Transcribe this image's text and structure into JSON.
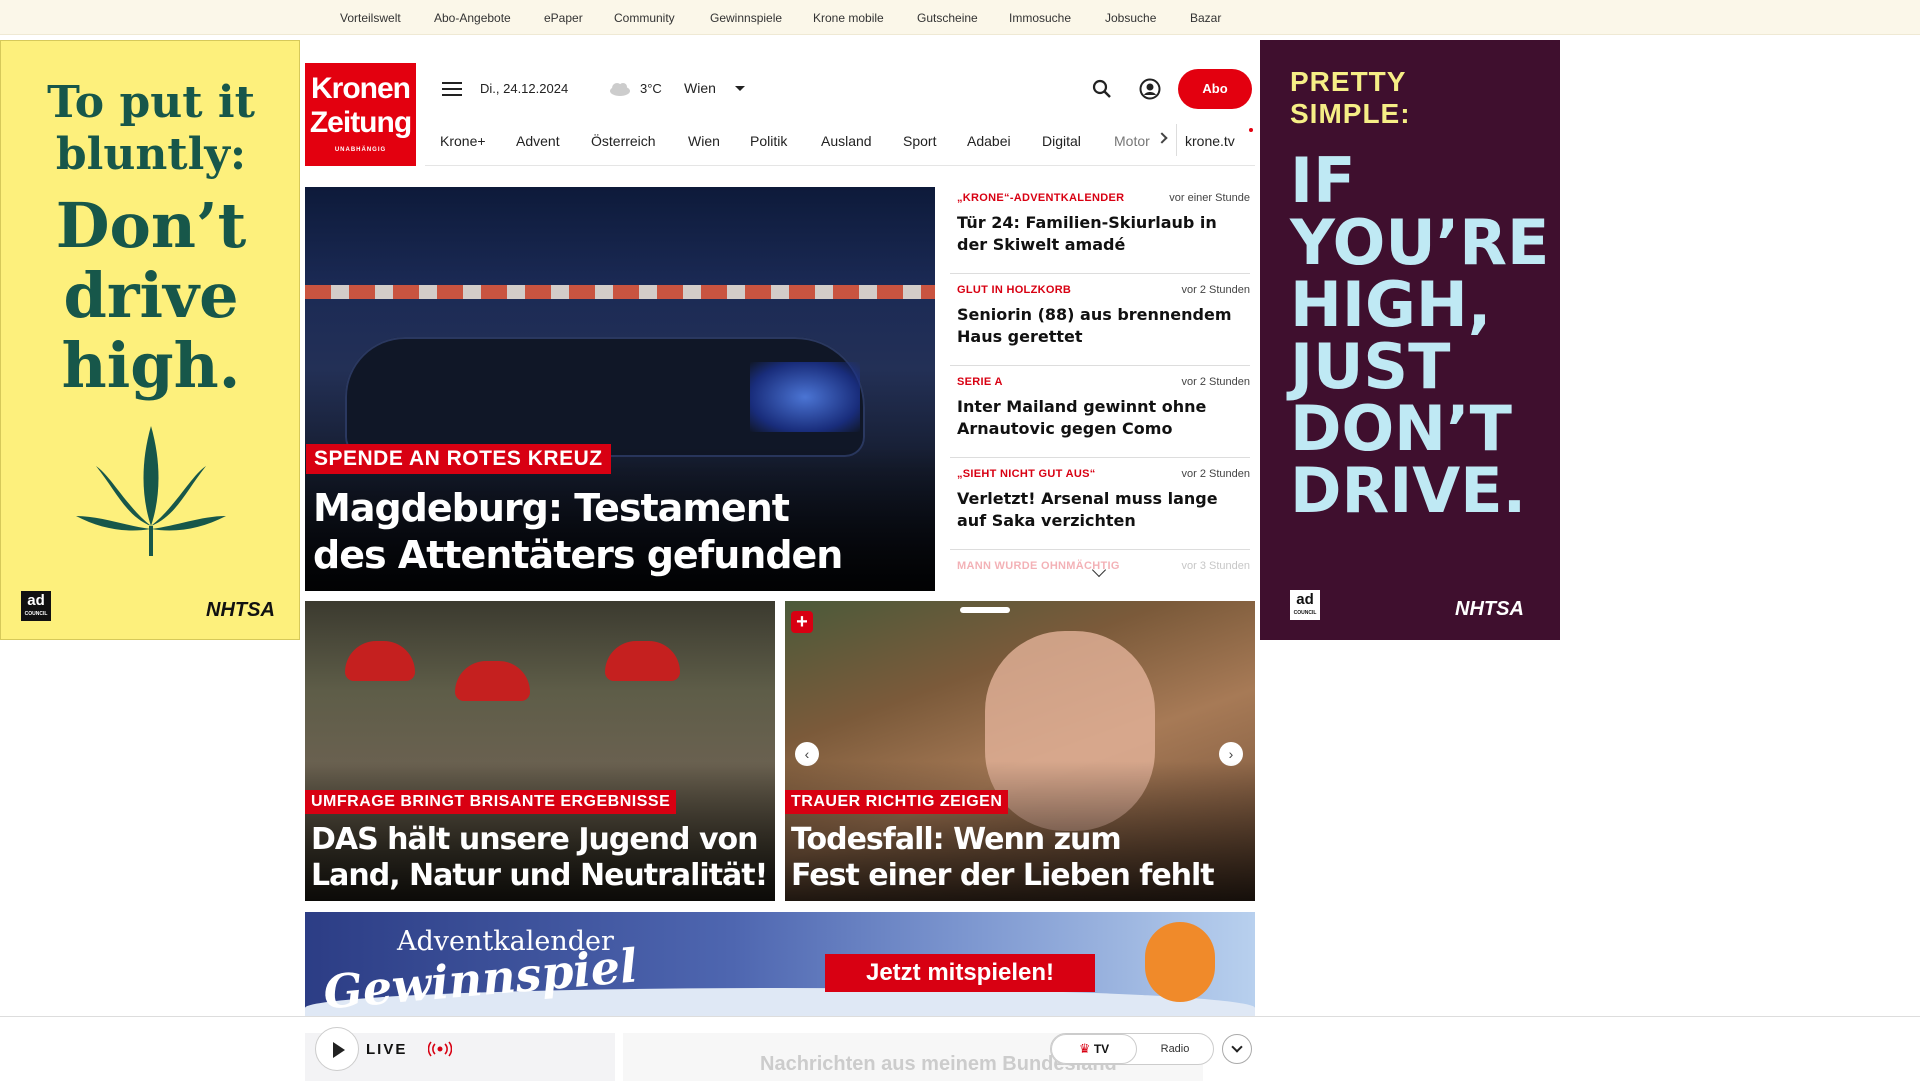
{
  "topnav": [
    "Vorteilswelt",
    "Abo-Angebote",
    "ePaper",
    "Community",
    "Gewinnspiele",
    "Krone mobile",
    "Gutscheine",
    "Immosuche",
    "Jobsuche",
    "Bazar"
  ],
  "ad_left": {
    "line1": "To put it",
    "line2": "bluntly:",
    "line3": "Don’t",
    "line4": "drive",
    "line5": "high.",
    "ad_council": "ad",
    "ad_council_sub": "COUNCIL",
    "nhtsa": "NHTSA"
  },
  "ad_right": {
    "top1": "PRETTY",
    "top2": "SIMPLE:",
    "l1": "IF",
    "l2": "YOU’RE",
    "l3": "HIGH,",
    "l4": "JUST",
    "l5": "DON’T",
    "l6": "DRIVE.",
    "ad_council": "ad",
    "ad_council_sub": "COUNCIL",
    "nhtsa": "NHTSA"
  },
  "logo": {
    "line1": "Kronen",
    "line2": "Zeitung",
    "sub": "UNABHÄNGIG"
  },
  "header": {
    "date": "Di., 24.12.2024",
    "temp": "3°C",
    "city": "Wien",
    "abo": "Abo"
  },
  "nav": [
    "Krone+",
    "Advent",
    "Österreich",
    "Wien",
    "Politik",
    "Ausland",
    "Sport",
    "Adabei",
    "Digital",
    "Motor"
  ],
  "nav_tv": "krone.tv",
  "hero": {
    "tag": "SPENDE AN ROTES KREUZ",
    "title1": "Magdeburg: Testament",
    "title2": "des Attentäters gefunden"
  },
  "news": [
    {
      "kicker": "„KRONE“-ADVENTKALENDER",
      "time": "vor einer Stunde",
      "title": "Tür 24: Familien-Skiurlaub in der Skiwelt amadé"
    },
    {
      "kicker": "GLUT IN HOLZKORB",
      "time": "vor 2 Stunden",
      "title": "Seniorin (88) aus brennendem Haus gerettet"
    },
    {
      "kicker": "SERIE A",
      "time": "vor 2 Stunden",
      "title": "Inter Mailand gewinnt ohne Arnautovic gegen Como"
    },
    {
      "kicker": "„SIEHT NICHT GUT AUS“",
      "time": "vor 2 Stunden",
      "title": "Verletzt! Arsenal muss lange auf Saka verzichten"
    },
    {
      "kicker": "MANN WURDE OHNMÄCHTIG",
      "time": "vor 3 Stunden",
      "title": ""
    }
  ],
  "card1": {
    "tag": "UMFRAGE BRINGT BRISANTE ERGEBNISSE",
    "title1": "DAS hält unsere Jugend von",
    "title2": "Land, Natur und Neutralität!"
  },
  "card2": {
    "tag": "TRAUER RICHTIG ZEIGEN",
    "title1": "Todesfall: Wenn zum",
    "title2": "Fest einer der Lieben fehlt"
  },
  "banner": {
    "line1": "Adventkalender",
    "line2": "Gewinnspiel",
    "cta": "Jetzt mitspielen!"
  },
  "player": {
    "live": "LIVE",
    "tv": "TV",
    "radio": "Radio",
    "behind": "Nachrichten aus meinem Bundesland"
  }
}
